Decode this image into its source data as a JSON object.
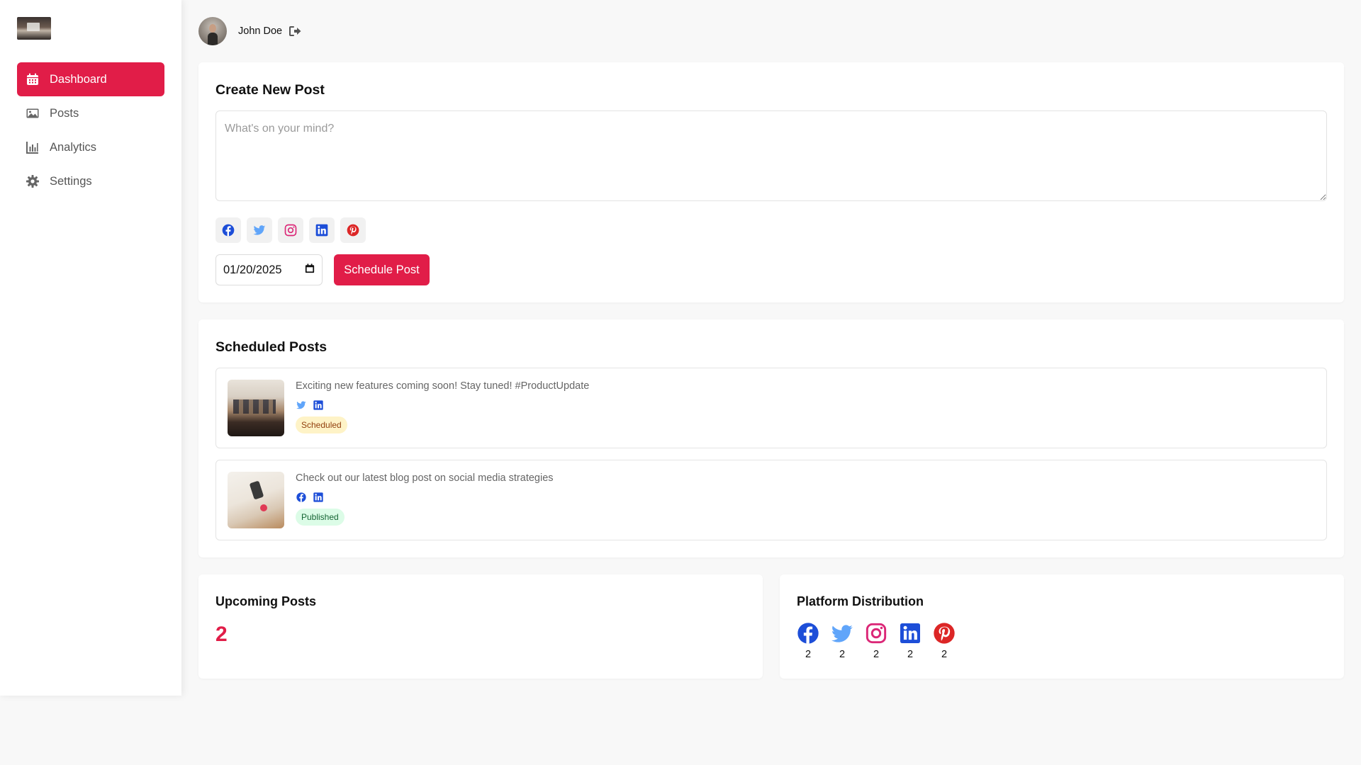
{
  "sidebar": {
    "logo": "logo",
    "items": [
      {
        "label": "Dashboard",
        "icon": "calendar-icon",
        "active": true
      },
      {
        "label": "Posts",
        "icon": "image-icon",
        "active": false
      },
      {
        "label": "Analytics",
        "icon": "chart-icon",
        "active": false
      },
      {
        "label": "Settings",
        "icon": "gear-icon",
        "active": false
      }
    ]
  },
  "header": {
    "user_name": "John Doe",
    "logout_icon": "logout-icon"
  },
  "create_post": {
    "title": "Create New Post",
    "placeholder": "What's on your mind?",
    "platforms": [
      "facebook-icon",
      "twitter-icon",
      "instagram-icon",
      "linkedin-icon",
      "pinterest-icon"
    ],
    "date_value": "01/20/2025",
    "schedule_label": "Schedule Post"
  },
  "scheduled_posts": {
    "title": "Scheduled Posts",
    "items": [
      {
        "text": "Exciting new features coming soon! Stay tuned! #ProductUpdate",
        "platforms": [
          "twitter-icon",
          "linkedin-icon"
        ],
        "status": "Scheduled"
      },
      {
        "text": "Check out our latest blog post on social media strategies",
        "platforms": [
          "facebook-icon",
          "linkedin-icon"
        ],
        "status": "Published"
      }
    ]
  },
  "upcoming": {
    "title": "Upcoming Posts",
    "count": "2"
  },
  "distribution": {
    "title": "Platform Distribution",
    "items": [
      {
        "icon": "facebook-icon",
        "count": "2"
      },
      {
        "icon": "twitter-icon",
        "count": "2"
      },
      {
        "icon": "instagram-icon",
        "count": "2"
      },
      {
        "icon": "linkedin-icon",
        "count": "2"
      },
      {
        "icon": "pinterest-icon",
        "count": "2"
      }
    ]
  },
  "colors": {
    "accent": "#e11d48",
    "facebook": "#1d4ed8",
    "twitter": "#60a5fa",
    "instagram": "#db2777",
    "linkedin": "#1d4ed8",
    "pinterest": "#dc2626",
    "scheduled_bg": "#fef3c7",
    "published_bg": "#dcfce7"
  }
}
